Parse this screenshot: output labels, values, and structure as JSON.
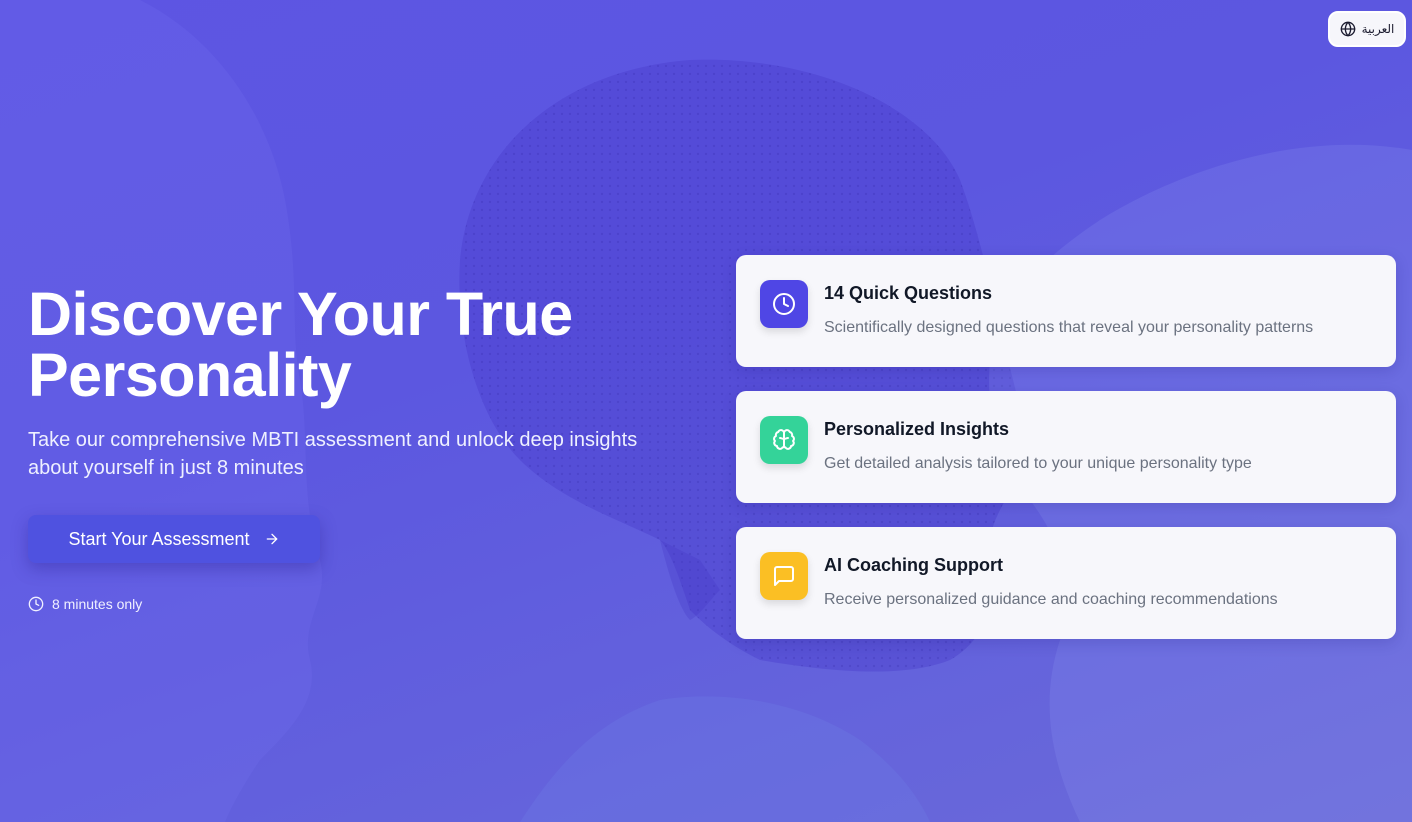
{
  "language_button": {
    "label": "العربية",
    "icon": "globe-icon"
  },
  "hero": {
    "title_line1": "Discover Your True",
    "title_line2": "Personality",
    "subtitle_line1": "Take our comprehensive MBTI assessment and unlock deep insights",
    "subtitle_line2": "about yourself in just 8 minutes",
    "cta_label": "Start Your Assessment",
    "cta_icon": "arrow-right-icon",
    "duration_label": "8 minutes only",
    "duration_icon": "clock-icon"
  },
  "features": [
    {
      "title": "14 Quick Questions",
      "description": "Scientifically designed questions that reveal your personality patterns",
      "icon": "clock-icon",
      "color": "#4f46e5"
    },
    {
      "title": "Personalized Insights",
      "description": "Get detailed analysis tailored to your unique personality type",
      "icon": "brain-icon",
      "color": "#34d399"
    },
    {
      "title": "AI Coaching Support",
      "description": "Receive personalized guidance and coaching recommendations",
      "icon": "chat-icon",
      "color": "#fbbf24"
    }
  ],
  "colors": {
    "background": "#5d55e3",
    "cta": "#4f52e0",
    "card_bg": "#f7f7fb"
  }
}
